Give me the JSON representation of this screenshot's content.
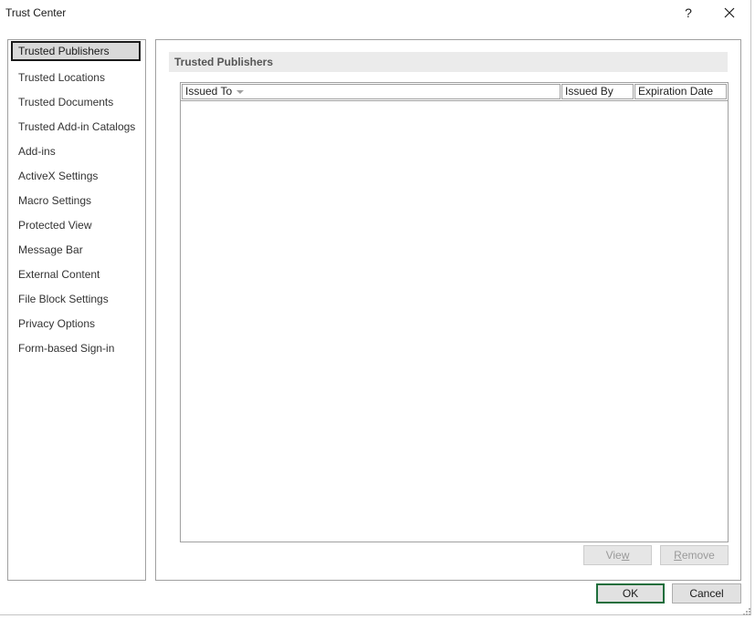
{
  "window": {
    "title": "Trust Center",
    "help_label": "?",
    "close_icon": "close-icon"
  },
  "sidebar": {
    "selected_index": 0,
    "items": [
      {
        "label": "Trusted Publishers"
      },
      {
        "label": "Trusted Locations"
      },
      {
        "label": "Trusted Documents"
      },
      {
        "label": "Trusted Add-in Catalogs"
      },
      {
        "label": "Add-ins"
      },
      {
        "label": "ActiveX Settings"
      },
      {
        "label": "Macro Settings"
      },
      {
        "label": "Protected View"
      },
      {
        "label": "Message Bar"
      },
      {
        "label": "External Content"
      },
      {
        "label": "File Block Settings"
      },
      {
        "label": "Privacy Options"
      },
      {
        "label": "Form-based Sign-in"
      }
    ]
  },
  "main": {
    "section_title": "Trusted Publishers",
    "table": {
      "columns": [
        "Issued To",
        "Issued By",
        "Expiration Date"
      ],
      "sort_icon": "sort-down-icon",
      "rows": []
    },
    "view_button": {
      "prefix": "Vie",
      "accel": "w",
      "suffix": ""
    },
    "remove_button": {
      "prefix": "",
      "accel": "R",
      "suffix": "emove"
    }
  },
  "footer": {
    "ok_label": "OK",
    "cancel_label": "Cancel"
  },
  "colors": {
    "default_button_border": "#1e6e3c",
    "selected_nav_bg": "#d9d9d9",
    "section_header_bg": "#ebebeb"
  }
}
